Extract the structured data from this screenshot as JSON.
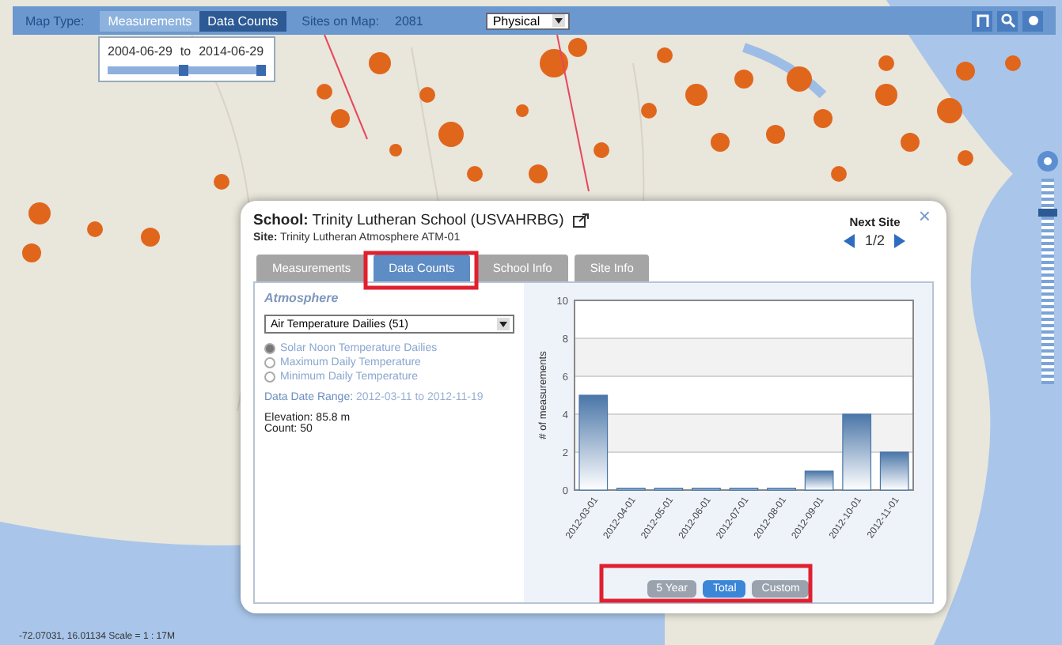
{
  "toolbar": {
    "map_type_label": "Map Type:",
    "map_types": [
      {
        "label": "Measurements",
        "selected": false
      },
      {
        "label": "Data Counts",
        "selected": true
      }
    ],
    "sites_label": "Sites on Map:",
    "sites_count": "2081",
    "layer_select": "Physical"
  },
  "date_range": {
    "from": "2004-06-29",
    "to_label": "to",
    "to": "2014-06-29",
    "slider": {
      "level": 0.48
    }
  },
  "zoom": {
    "level": 0.85
  },
  "dialog": {
    "school_label": "School:",
    "school": "Trinity Lutheran School (USVAHRBG)",
    "site_label": "Site:",
    "site": "Trinity Lutheran Atmosphere ATM-01",
    "next_site": "Next Site",
    "page": "1/2",
    "close": "×",
    "tabs": [
      {
        "label": "Measurements",
        "selected": false
      },
      {
        "label": "Data Counts",
        "selected": true
      },
      {
        "label": "School Info",
        "selected": false
      },
      {
        "label": "Site Info",
        "selected": false
      }
    ],
    "section": "Atmosphere",
    "protocol_select": "Air Temperature Dailies (51)",
    "options": [
      {
        "label": "Solar Noon Temperature Dailies",
        "selected": true
      },
      {
        "label": "Maximum Daily Temperature",
        "selected": false
      },
      {
        "label": "Minimum Daily Temperature",
        "selected": false
      }
    ],
    "date_range_label": "Data Date Range:",
    "date_range_value": "2012-03-11 to 2012-11-19",
    "elevation": "Elevation: 85.8 m",
    "count": "Count: 50",
    "chart_data": {
      "type": "bar",
      "ylabel": "# of measurements",
      "categories": [
        "2012-03-01",
        "2012-04-01",
        "2012-05-01",
        "2012-06-01",
        "2012-07-01",
        "2012-08-01",
        "2012-09-01",
        "2012-10-01",
        "2012-11-01"
      ],
      "values": [
        5,
        0,
        0,
        0,
        0,
        0,
        1,
        4,
        2
      ],
      "ylim": [
        0,
        10
      ],
      "yticks": [
        0,
        2,
        4,
        6,
        8,
        10
      ],
      "grid": true
    },
    "range_buttons": [
      {
        "label": "5 Year",
        "selected": false
      },
      {
        "label": "Total",
        "selected": true
      },
      {
        "label": "Custom",
        "selected": false
      }
    ]
  },
  "status_bar": "-72.07031, 16.01134 Scale = 1 : 17M"
}
